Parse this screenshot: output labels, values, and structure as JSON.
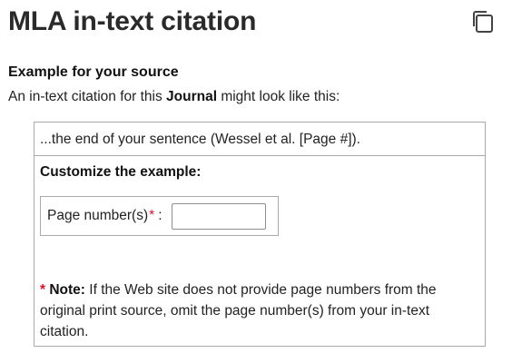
{
  "header": {
    "title": "MLA in-text citation",
    "copy_icon": "copy-icon"
  },
  "source": {
    "heading": "Example for your source",
    "intro_prefix": "An in-text citation for this",
    "source_type": "Journal",
    "intro_suffix": "might look like this:"
  },
  "example": {
    "citation_text": "...the end of your sentence (Wessel et al. [Page #])."
  },
  "customize": {
    "heading": "Customize the example:",
    "field_label": "Page number(s)",
    "required_marker": "*",
    "colon": ":",
    "field_value": ""
  },
  "note": {
    "star": "*",
    "label": "Note:",
    "text": "If the Web site does not provide page numbers from the original print source, omit the page number(s) from your in-text citation."
  },
  "colors": {
    "required": "#e0102a",
    "border": "#a9a9a9",
    "text": "#222222"
  }
}
